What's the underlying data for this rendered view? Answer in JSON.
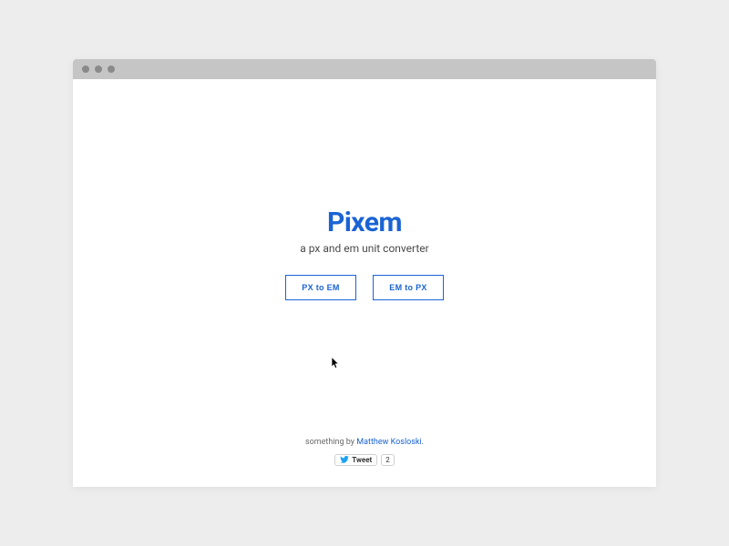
{
  "app": {
    "title": "Pixem",
    "subtitle": "a px and em unit converter"
  },
  "buttons": {
    "px_to_em": "PX to EM",
    "em_to_px": "EM to PX"
  },
  "footer": {
    "prefix": "something by ",
    "author": "Matthew Kosloski",
    "suffix": "."
  },
  "tweet": {
    "label": "Tweet",
    "count": "2"
  },
  "colors": {
    "accent": "#1a63d4",
    "page_bg": "#ededed",
    "titlebar": "#c5c5c5"
  }
}
